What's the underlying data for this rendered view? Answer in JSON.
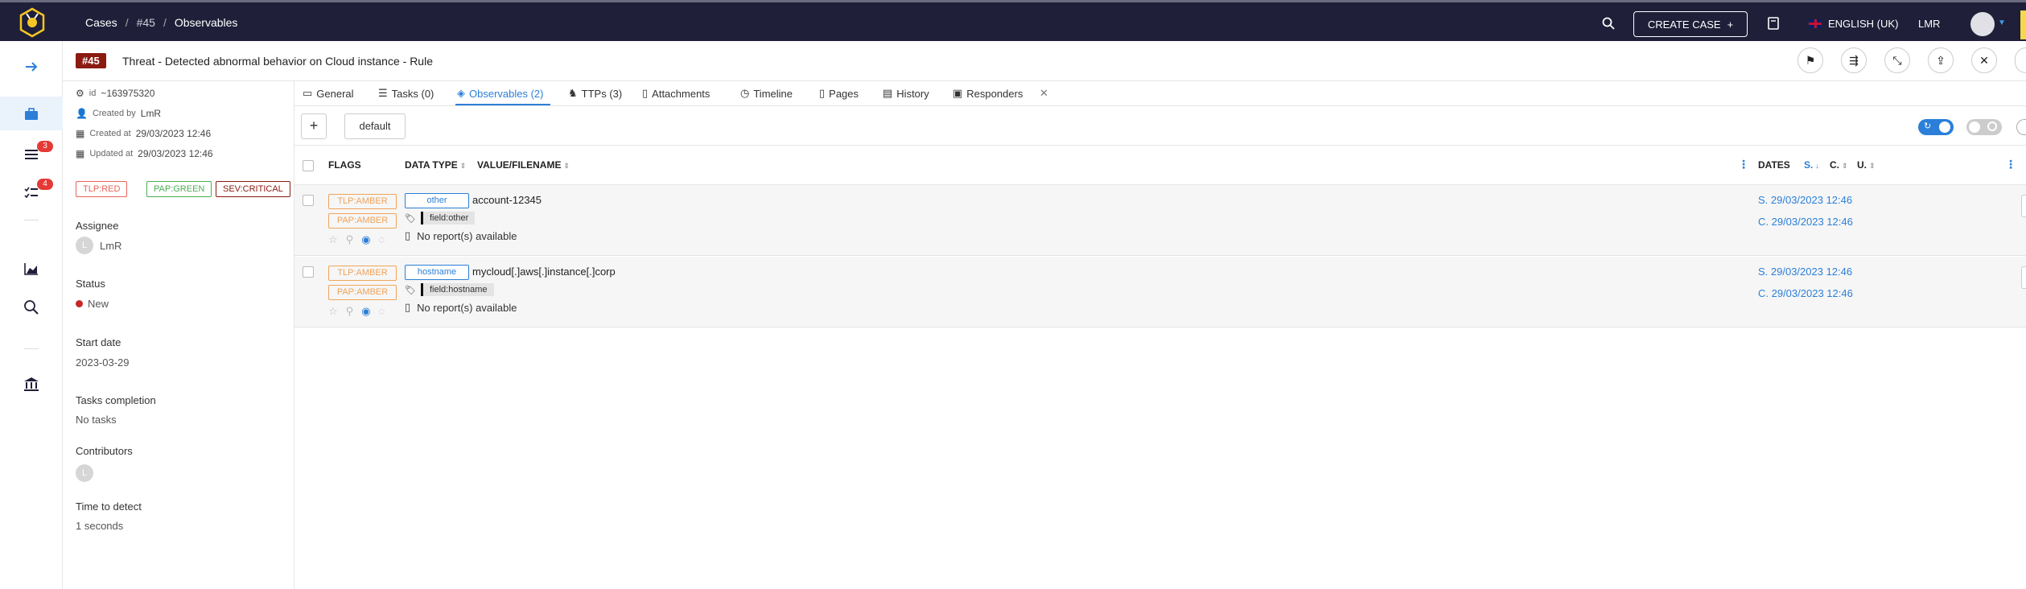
{
  "breadcrumb": {
    "cases": "Cases",
    "case_ref": "#45",
    "current": "Observables"
  },
  "topbar": {
    "create_case": "CREATE CASE",
    "language": "ENGLISH (UK)",
    "user": "LMR"
  },
  "sidenav": {
    "tasks_badge": "3",
    "todo_badge": "4"
  },
  "case": {
    "number": "#45",
    "title": "Threat - Detected abnormal behavior on Cloud instance - Rule"
  },
  "details": {
    "id_label": "id",
    "id": "~163975320",
    "created_by_label": "Created by",
    "created_by": "LmR",
    "created_at_label": "Created at",
    "created_at": "29/03/2023 12:46",
    "updated_at_label": "Updated at",
    "updated_at": "29/03/2023 12:46",
    "tags": [
      "TLP:RED",
      "PAP:GREEN",
      "SEV:CRITICAL"
    ],
    "assignee_label": "Assignee",
    "assignee_initial": "L",
    "assignee": "LmR",
    "status_label": "Status",
    "status": "New",
    "start_date_label": "Start date",
    "start_date": "2023-03-29",
    "tasks_completion_label": "Tasks completion",
    "tasks_completion": "No tasks",
    "contributors_label": "Contributors",
    "contributor_initial": "L",
    "time_to_detect_label": "Time to detect",
    "time_to_detect": "1 seconds"
  },
  "tabs": [
    "General",
    "Tasks (0)",
    "Observables (2)",
    "TTPs (3)",
    "Attachments",
    "Timeline",
    "Pages",
    "History",
    "Responders"
  ],
  "toolbar": {
    "add": "+",
    "preset": "default"
  },
  "table": {
    "headers": {
      "flags": "FLAGS",
      "data_type": "DATA TYPE",
      "value": "VALUE/FILENAME",
      "dates": "DATES",
      "s": "S.",
      "c": "C.",
      "u": "U."
    },
    "rows": [
      {
        "tlp": "TLP:AMBER",
        "pap": "PAP:AMBER",
        "data_type": "other",
        "value": "account-12345",
        "tag": "field:other",
        "report": "No report(s) available",
        "start": "S. 29/03/2023 12:46",
        "created": "C. 29/03/2023 12:46"
      },
      {
        "tlp": "TLP:AMBER",
        "pap": "PAP:AMBER",
        "data_type": "hostname",
        "value": "mycloud[.]aws[.]instance[.]corp",
        "tag": "field:hostname",
        "report": "No report(s) available",
        "start": "S. 29/03/2023 12:46",
        "created": "C. 29/03/2023 12:46"
      }
    ]
  },
  "colors": {
    "topbar": "#1f1f39",
    "accent": "#2b7fd8",
    "case_badge": "#8b1a10",
    "amber": "#f0a35a"
  }
}
